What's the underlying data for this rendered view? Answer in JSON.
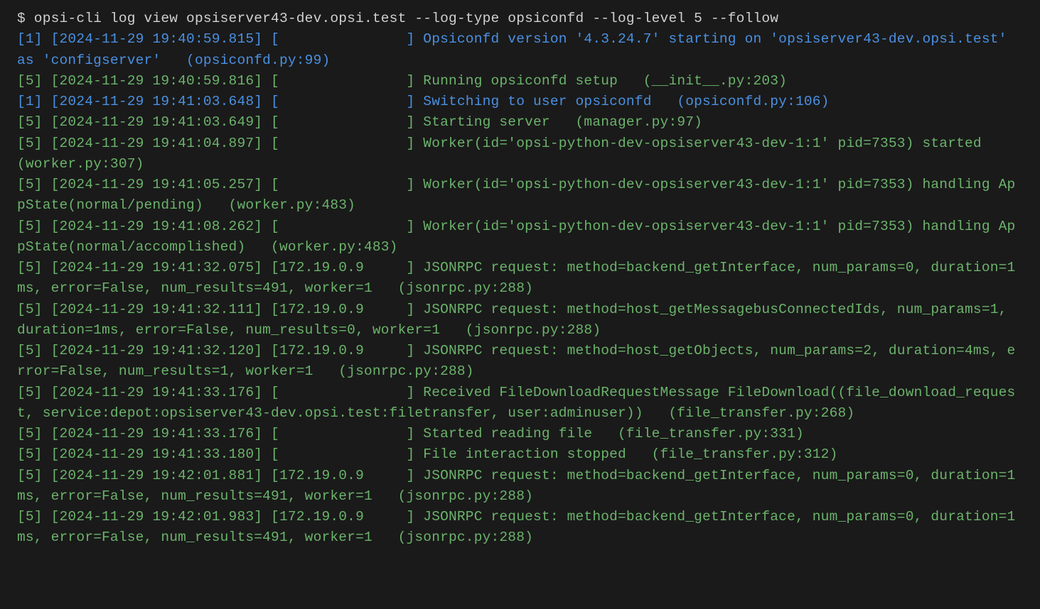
{
  "prompt": "$ opsi-cli log view opsiserver43-dev.opsi.test --log-type opsiconfd --log-level 5 --follow",
  "logs": [
    {
      "lv": 1,
      "text": "[1] [2024-11-29 19:40:59.815] [               ] Opsiconfd version '4.3.24.7' starting on 'opsiserver43-dev.opsi.test' as 'configserver'   (opsiconfd.py:99)"
    },
    {
      "lv": 5,
      "text": "[5] [2024-11-29 19:40:59.816] [               ] Running opsiconfd setup   (__init__.py:203)"
    },
    {
      "lv": 1,
      "text": "[1] [2024-11-29 19:41:03.648] [               ] Switching to user opsiconfd   (opsiconfd.py:106)"
    },
    {
      "lv": 5,
      "text": "[5] [2024-11-29 19:41:03.649] [               ] Starting server   (manager.py:97)"
    },
    {
      "lv": 5,
      "text": "[5] [2024-11-29 19:41:04.897] [               ] Worker(id='opsi-python-dev-opsiserver43-dev-1:1' pid=7353) started   (worker.py:307)"
    },
    {
      "lv": 5,
      "text": "[5] [2024-11-29 19:41:05.257] [               ] Worker(id='opsi-python-dev-opsiserver43-dev-1:1' pid=7353) handling AppState(normal/pending)   (worker.py:483)"
    },
    {
      "lv": 5,
      "text": "[5] [2024-11-29 19:41:08.262] [               ] Worker(id='opsi-python-dev-opsiserver43-dev-1:1' pid=7353) handling AppState(normal/accomplished)   (worker.py:483)"
    },
    {
      "lv": 5,
      "text": "[5] [2024-11-29 19:41:32.075] [172.19.0.9     ] JSONRPC request: method=backend_getInterface, num_params=0, duration=1ms, error=False, num_results=491, worker=1   (jsonrpc.py:288)"
    },
    {
      "lv": 5,
      "text": "[5] [2024-11-29 19:41:32.111] [172.19.0.9     ] JSONRPC request: method=host_getMessagebusConnectedIds, num_params=1, duration=1ms, error=False, num_results=0, worker=1   (jsonrpc.py:288)"
    },
    {
      "lv": 5,
      "text": "[5] [2024-11-29 19:41:32.120] [172.19.0.9     ] JSONRPC request: method=host_getObjects, num_params=2, duration=4ms, error=False, num_results=1, worker=1   (jsonrpc.py:288)"
    },
    {
      "lv": 5,
      "text": "[5] [2024-11-29 19:41:33.176] [               ] Received FileDownloadRequestMessage FileDownload((file_download_request, service:depot:opsiserver43-dev.opsi.test:filetransfer, user:adminuser))   (file_transfer.py:268)"
    },
    {
      "lv": 5,
      "text": "[5] [2024-11-29 19:41:33.176] [               ] Started reading file   (file_transfer.py:331)"
    },
    {
      "lv": 5,
      "text": "[5] [2024-11-29 19:41:33.180] [               ] File interaction stopped   (file_transfer.py:312)"
    },
    {
      "lv": 5,
      "text": "[5] [2024-11-29 19:42:01.881] [172.19.0.9     ] JSONRPC request: method=backend_getInterface, num_params=0, duration=1ms, error=False, num_results=491, worker=1   (jsonrpc.py:288)"
    },
    {
      "lv": 5,
      "text": "[5] [2024-11-29 19:42:01.983] [172.19.0.9     ] JSONRPC request: method=backend_getInterface, num_params=0, duration=1ms, error=False, num_results=491, worker=1   (jsonrpc.py:288)"
    }
  ]
}
